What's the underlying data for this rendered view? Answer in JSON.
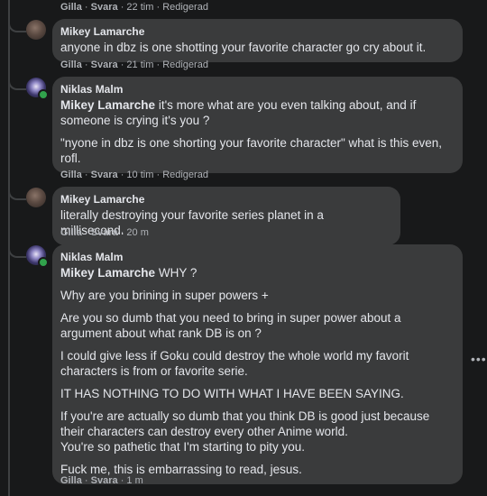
{
  "comments": [
    {
      "meta": {
        "reply": "Gilla",
        "sep1": "·",
        "answer": "Svara",
        "sep2": "·",
        "time": "22 tim",
        "sep3": "·",
        "edited": "Redigerad"
      }
    },
    {
      "author": "Mikey Lamarche",
      "avatar": "mikey-avatar",
      "paragraphs": [
        "anyone in dbz is one shotting your favorite character go cry about it."
      ],
      "meta": {
        "reply": "Gilla",
        "sep1": "·",
        "answer": "Svara",
        "sep2": "·",
        "time": "21 tim",
        "sep3": "·",
        "edited": "Redigerad"
      }
    },
    {
      "author": "Niklas Malm",
      "avatar": "niklas-avatar",
      "tag": "Mikey Lamarche",
      "paragraphs": [
        "it's more what are you even talking about, and if someone is crying it's you ?",
        "\"nyone in dbz is one shorting your favorite character\" what is this even, rofl."
      ],
      "meta": {
        "reply": "Gilla",
        "sep1": "·",
        "answer": "Svara",
        "sep2": "·",
        "time": "10 tim",
        "sep3": "·",
        "edited": "Redigerad"
      }
    },
    {
      "author": "Mikey Lamarche",
      "avatar": "mikey-avatar",
      "paragraphs": [
        "literally destroying your favorite series planet in a millisecond."
      ],
      "meta": {
        "reply": "Gilla",
        "sep1": "·",
        "answer": "Svara",
        "sep2": "·",
        "time": "20 m"
      }
    },
    {
      "author": "Niklas Malm",
      "avatar": "niklas-avatar",
      "tag": "Mikey Lamarche",
      "paragraphs": [
        "WHY ?",
        "Why are you brining in super powers +",
        "Are you so dumb that you need to bring in super power about a argument about what rank DB is on ?",
        "I could give less if Goku could destroy the whole world my favorit characters is from or favorite serie.",
        "IT HAS NOTHING TO DO WITH WHAT I HAVE BEEN SAYING.",
        "If you're are actually so dumb that you think DB is good just because their characters can destroy every other Anime world.",
        "You're so pathetic that I'm starting to pity you.",
        "Fuck me, this is embarrassing to read, jesus."
      ],
      "meta": {
        "reply": "Gilla",
        "sep1": "·",
        "answer": "Svara",
        "sep2": "·",
        "time": "1 m"
      }
    }
  ],
  "more_icon": "more-horizontal-icon",
  "colors": {
    "background": "#18191a",
    "bubble": "#3a3b3c",
    "online": "#31a24c"
  }
}
